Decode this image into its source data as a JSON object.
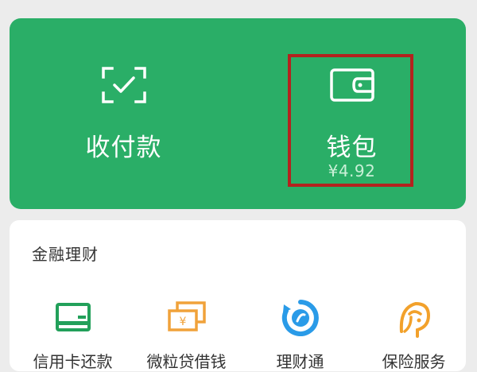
{
  "wallet_panel": {
    "pay_label": "收付款",
    "wallet_label": "钱包",
    "wallet_balance": "¥4.92"
  },
  "finance_section": {
    "title": "金融理财",
    "items": [
      {
        "label": "信用卡还款",
        "icon": "credit-card-icon"
      },
      {
        "label": "微粒贷借钱",
        "icon": "cash-stack-icon"
      },
      {
        "label": "理财通",
        "icon": "wealth-refresh-icon"
      },
      {
        "label": "保险服务",
        "icon": "umbrella-person-icon"
      }
    ]
  },
  "colors": {
    "brand_green": "#2aae67",
    "highlight_red": "#b3221e",
    "icon_green": "#22a05a",
    "icon_orange": "#f0a23a",
    "icon_blue": "#2a9be8",
    "icon_gold": "#f2a12b"
  }
}
